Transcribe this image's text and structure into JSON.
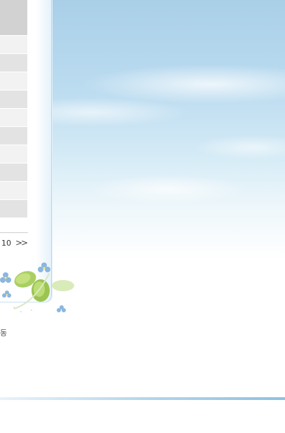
{
  "table": {
    "rows": [
      "",
      "",
      "",
      "",
      "",
      "",
      "",
      "",
      "",
      ""
    ]
  },
  "pager": {
    "last_page": "10",
    "next_label": ">>"
  },
  "footer": {
    "partial_text": "동"
  },
  "colors": {
    "sky_top": "#a9cfe8",
    "panel_border": "#b8d8ee",
    "row_light": "#f2f2f2",
    "row_dark": "#e3e3e3",
    "footer_line": "#8fc0e0"
  }
}
